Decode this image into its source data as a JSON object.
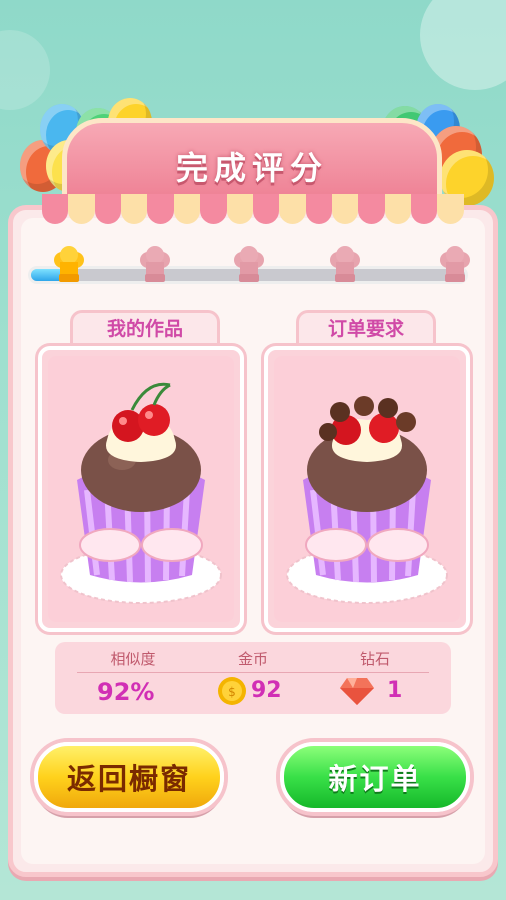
{
  "title": "完成评分",
  "progress": {
    "filled_fraction": 0.08,
    "total_steps": 5,
    "completed_steps": 1
  },
  "tabs": {
    "my_work": "我的作品",
    "order_request": "订单要求"
  },
  "stats": {
    "similarity_label": "相似度",
    "coins_label": "金币",
    "diamonds_label": "钻石",
    "similarity_value": "92%",
    "coins_value": "92",
    "diamonds_value": "1"
  },
  "buttons": {
    "back_label": "返回橱窗",
    "new_order_label": "新订单"
  },
  "colors": {
    "accent_pink": "#ee7f93",
    "text_magenta": "#d12fb5",
    "button_yellow": "#ffd21c",
    "button_green": "#39e048"
  }
}
